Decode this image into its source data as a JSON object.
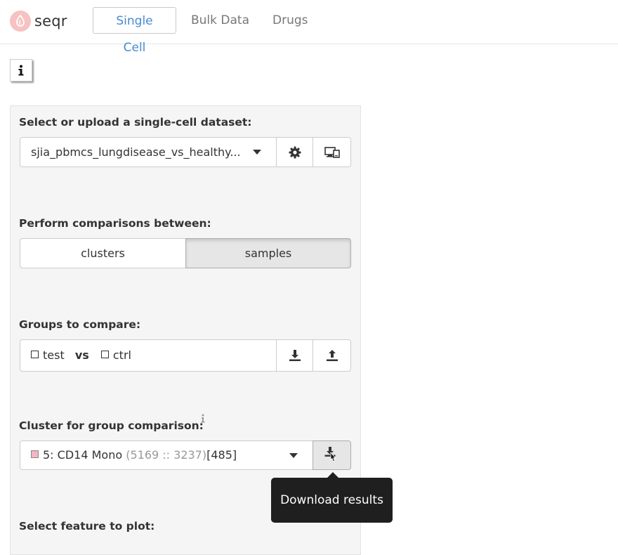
{
  "brand": {
    "name": "seqr"
  },
  "nav": {
    "tabs": [
      "Single Cell",
      "Bulk Data",
      "Drugs"
    ]
  },
  "dataset": {
    "label": "Select or upload a single-cell dataset:",
    "value": "sjia_pbmcs_lungdisease_vs_healthy..."
  },
  "comparisons": {
    "label": "Perform comparisons between:",
    "options": [
      "clusters",
      "samples"
    ],
    "selected": "samples"
  },
  "groups": {
    "label": "Groups to compare:",
    "test": "test",
    "vs": "vs",
    "ctrl": "ctrl"
  },
  "cluster": {
    "label": "Cluster for group comparison:",
    "name": "5: CD14 Mono",
    "counts": "(5169 :: 3237)",
    "count_bracket": "[485]",
    "swatch_color": "#f4b6c2"
  },
  "tooltip": {
    "text": "Download results"
  },
  "feature": {
    "label": "Select feature to plot:"
  },
  "colors": {
    "accent": "#4a8ad0",
    "panel_bg": "#f5f5f5",
    "selected_toggle": "#e6e6e6"
  }
}
